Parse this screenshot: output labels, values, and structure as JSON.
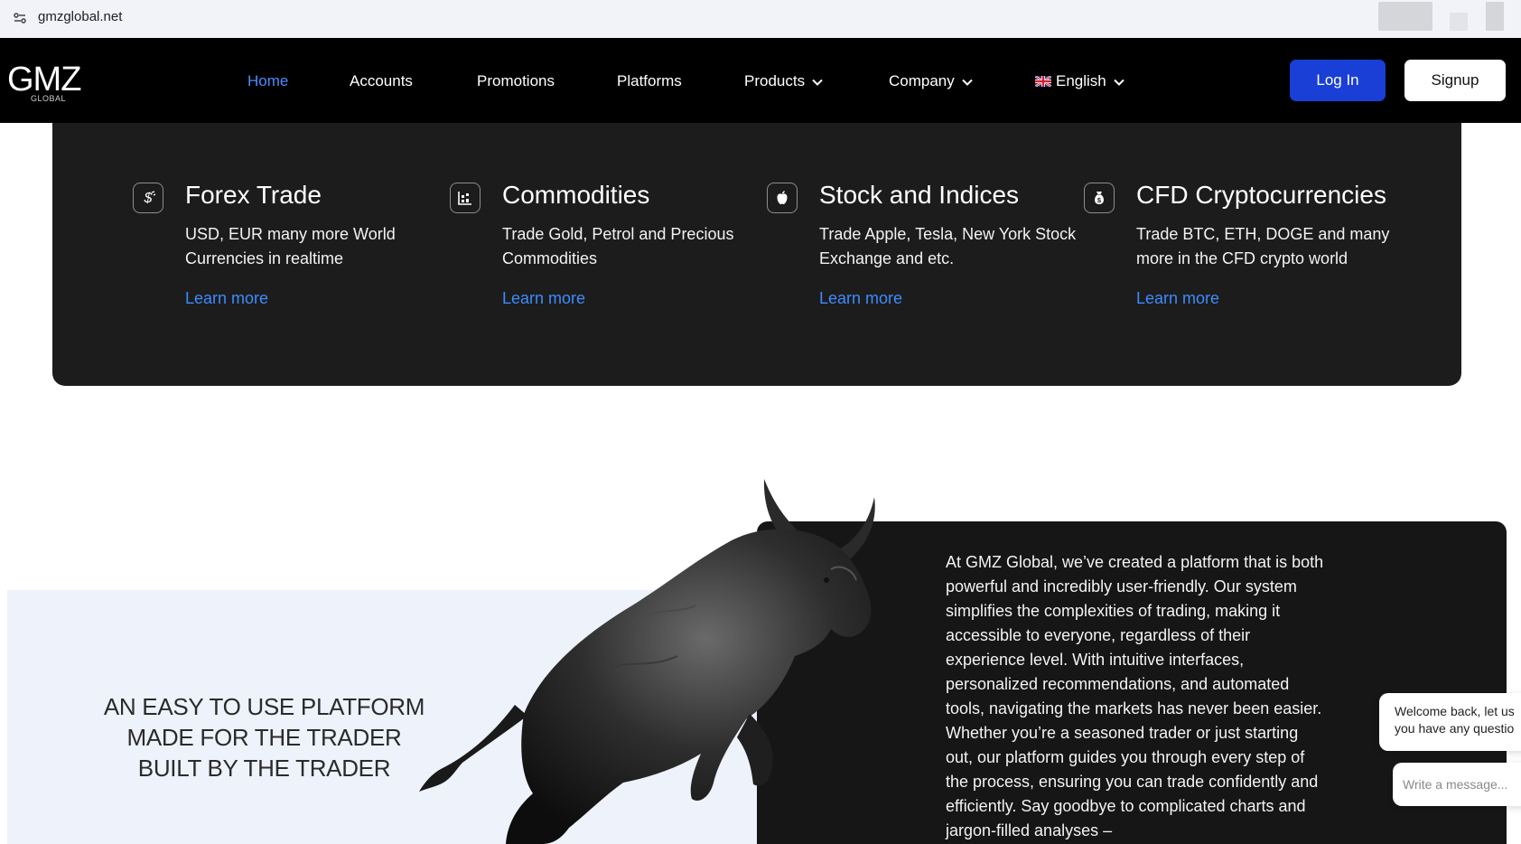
{
  "browser": {
    "url": "gmzglobal.net"
  },
  "logo": {
    "main": "GMZ",
    "sub": "GLOBAL"
  },
  "nav": {
    "items": [
      {
        "label": "Home",
        "active": true
      },
      {
        "label": "Accounts"
      },
      {
        "label": "Promotions"
      },
      {
        "label": "Platforms"
      },
      {
        "label": "Products",
        "dropdown": true
      },
      {
        "label": "Company",
        "dropdown": true
      }
    ],
    "language": {
      "label": "English",
      "flag": "uk-flag"
    },
    "login_label": "Log In",
    "signup_label": "Signup"
  },
  "products": [
    {
      "title": "Forex Trade",
      "desc": "USD, EUR many more World Currencies in realtime",
      "link": "Learn more",
      "icon": "dollar-icon"
    },
    {
      "title": "Commodities",
      "desc": "Trade Gold, Petrol and Precious Commodities",
      "link": "Learn more",
      "icon": "chart-icon"
    },
    {
      "title": "Stock and Indices",
      "desc": "Trade Apple, Tesla, New York Stock Exchange and etc.",
      "link": "Learn more",
      "icon": "apple-icon"
    },
    {
      "title": "CFD Cryptocurrencies",
      "desc": "Trade BTC, ETH, DOGE and many more in the CFD crypto world",
      "link": "Learn more",
      "icon": "money-bag-icon"
    }
  ],
  "tagline": {
    "line1": "AN EASY TO USE PLATFORM",
    "line2": "MADE FOR THE TRADER",
    "line3": "BUILT BY THE TRADER"
  },
  "about": {
    "text": "At GMZ Global, we’ve created a platform that is both powerful and incredibly user-friendly. Our system simplifies the complexities of trading, making it accessible to everyone, regardless of their experience level. With intuitive interfaces, personalized recommendations, and automated tools, navigating the markets has never been easier. Whether you’re a seasoned trader or just starting out, our platform guides you through every step of the process, ensuring you can trade confidently and efficiently. Say goodbye to complicated charts and jargon-filled analyses –"
  },
  "chat": {
    "line1": "Welcome back, let us",
    "line2": "you have any questio",
    "placeholder": "Write a message..."
  },
  "colors": {
    "accent": "#4a8cff",
    "login_bg": "#1a3fd6",
    "panel_dark": "#1c1c1c",
    "panel_light": "#edf2fb"
  }
}
